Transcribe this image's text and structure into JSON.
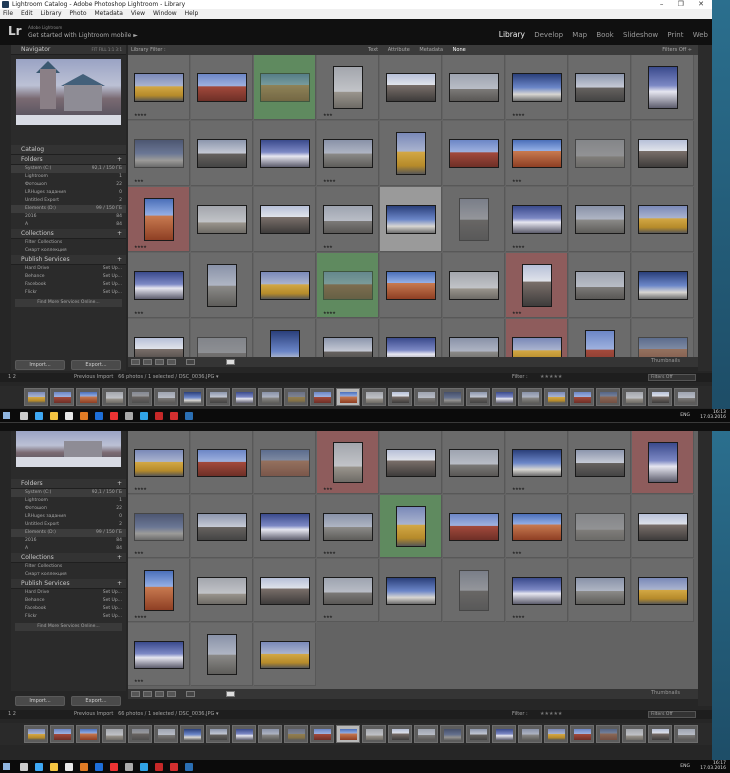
{
  "window": {
    "title": "Lightroom Catalog - Adobe Photoshop Lightroom - Library",
    "controls": "– ❐ ✕"
  },
  "menu": [
    "File",
    "Edit",
    "Library",
    "Photo",
    "Metadata",
    "View",
    "Window",
    "Help"
  ],
  "identity": {
    "logo": "Lr",
    "sub": "Adobe Lightroom",
    "main": "Get started with Lightroom mobile  ►"
  },
  "modules": [
    "Library",
    "Develop",
    "Map",
    "Book",
    "Slideshow",
    "Print",
    "Web"
  ],
  "active_module": "Library",
  "left_panel": {
    "navigator": "Navigator",
    "navigator_zoom": "FIT  FILL  1:1  3:1",
    "catalog": "Catalog",
    "folders": "Folders",
    "folder_rows": [
      {
        "label": "System (C:)",
        "num": "92,1 / 150 ГБ",
        "drive": true
      },
      {
        "label": "Lightroom",
        "num": "1",
        "drive": false
      },
      {
        "label": "Фотошоп",
        "num": "22",
        "drive": false
      },
      {
        "label": "LRHuges задания",
        "num": "0",
        "drive": false
      },
      {
        "label": "Untitled Export",
        "num": "2",
        "drive": false
      },
      {
        "label": "Elements (D:)",
        "num": "99 / 150 ГБ",
        "drive": true
      },
      {
        "label": "2016",
        "num": "84",
        "drive": false
      },
      {
        "label": "A",
        "num": "84",
        "drive": false
      }
    ],
    "collections": "Collections",
    "collection_rows": [
      {
        "label": "Filter Collections",
        "num": ""
      },
      {
        "label": "Смарт коллекция",
        "num": ""
      }
    ],
    "publish": "Publish Services",
    "publish_rows": [
      {
        "label": "Hard Drive",
        "num": "Set Up..."
      },
      {
        "label": "Behance",
        "num": "Set Up..."
      },
      {
        "label": "Facebook",
        "num": "Set Up..."
      },
      {
        "label": "Flickr",
        "num": "Set Up..."
      }
    ],
    "find_more": "Find More Services Online...",
    "import_label": "Import...",
    "export_label": "Export..."
  },
  "filter_bar": {
    "label": "Library Filter :",
    "options": [
      "Text",
      "Attribute",
      "Metadata",
      "None"
    ],
    "active": "None",
    "filters_off": "Filters Off ÷"
  },
  "toolbar": {
    "thumbnails": "Thumbnails"
  },
  "filmstrip_bar": {
    "pages": "1  2",
    "source": "Previous Import",
    "count": "66 photos / 1 selected / DSC_0036.JPG ▾",
    "filter": "Filter :",
    "filters_off": "Filters Off"
  },
  "taskbar": {
    "lang": "ENG",
    "time_a": "16:13",
    "date_a": "17.03.2016",
    "time_b": "16:17",
    "date_b": "17.03.2016"
  }
}
